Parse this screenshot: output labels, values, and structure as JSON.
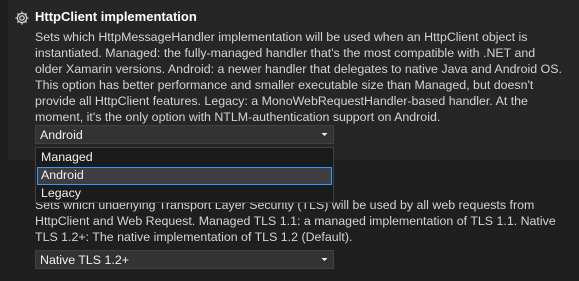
{
  "section1": {
    "icon": "gear-icon",
    "title": "HttpClient implementation",
    "description_lines": [
      "Sets which HttpMessageHandler implementation will be used when an HttpClient object is",
      "instantiated. Managed: the fully-managed handler that's the most compatible with .NET and",
      "older Xamarin versions. Android: a newer handler that delegates to native Java and Android OS.",
      "This option has better performance and smaller executable size than Managed, but doesn't",
      "provide all HttpClient features. Legacy: a MonoWebRequestHandler-based handler. At the",
      "moment, it's the only option with NTLM-authentication support on Android."
    ],
    "select": {
      "value": "Android",
      "icon": "chevron-down-icon",
      "dropdown_open": true,
      "options": [
        "Managed",
        "Android",
        "Legacy"
      ],
      "highlighted_index": 1
    }
  },
  "section2": {
    "description_lines": [
      "Sets which underlying Transport Layer Security (TLS) will be used by all web requests from",
      "HttpClient and Web Request. Managed TLS 1.1: a managed implementation of TLS 1.1. Native",
      "TLS 1.2+: The native implementation of TLS 1.2 (Default)."
    ],
    "select": {
      "value": "Native TLS 1.2+",
      "icon": "chevron-down-icon"
    }
  },
  "colors": {
    "background": "#1f1f1f",
    "panel": "#262626",
    "control": "#333333",
    "selection_border": "#3399ff"
  }
}
